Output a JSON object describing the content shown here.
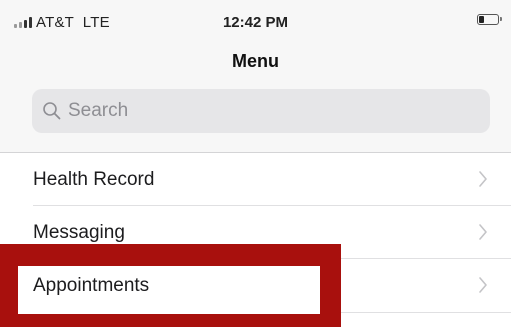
{
  "status_bar": {
    "carrier": "AT&T",
    "network": "LTE",
    "time": "12:42 PM",
    "signal_bars_filled": 2,
    "signal_bars_total": 4,
    "battery_level": 0.3
  },
  "nav": {
    "title": "Menu"
  },
  "search": {
    "placeholder": "Search",
    "value": ""
  },
  "menu": {
    "items": [
      {
        "label": "Health Record",
        "icon": "chevron-right-icon"
      },
      {
        "label": "Messaging",
        "icon": "chevron-right-icon"
      },
      {
        "label": "Appointments",
        "icon": "chevron-right-icon",
        "highlighted": true
      }
    ]
  },
  "colors": {
    "highlight": "#a8100d",
    "search_bg": "#e6e6e8",
    "chevron": "#c4c4c7",
    "header_bg": "#f7f7f7"
  }
}
